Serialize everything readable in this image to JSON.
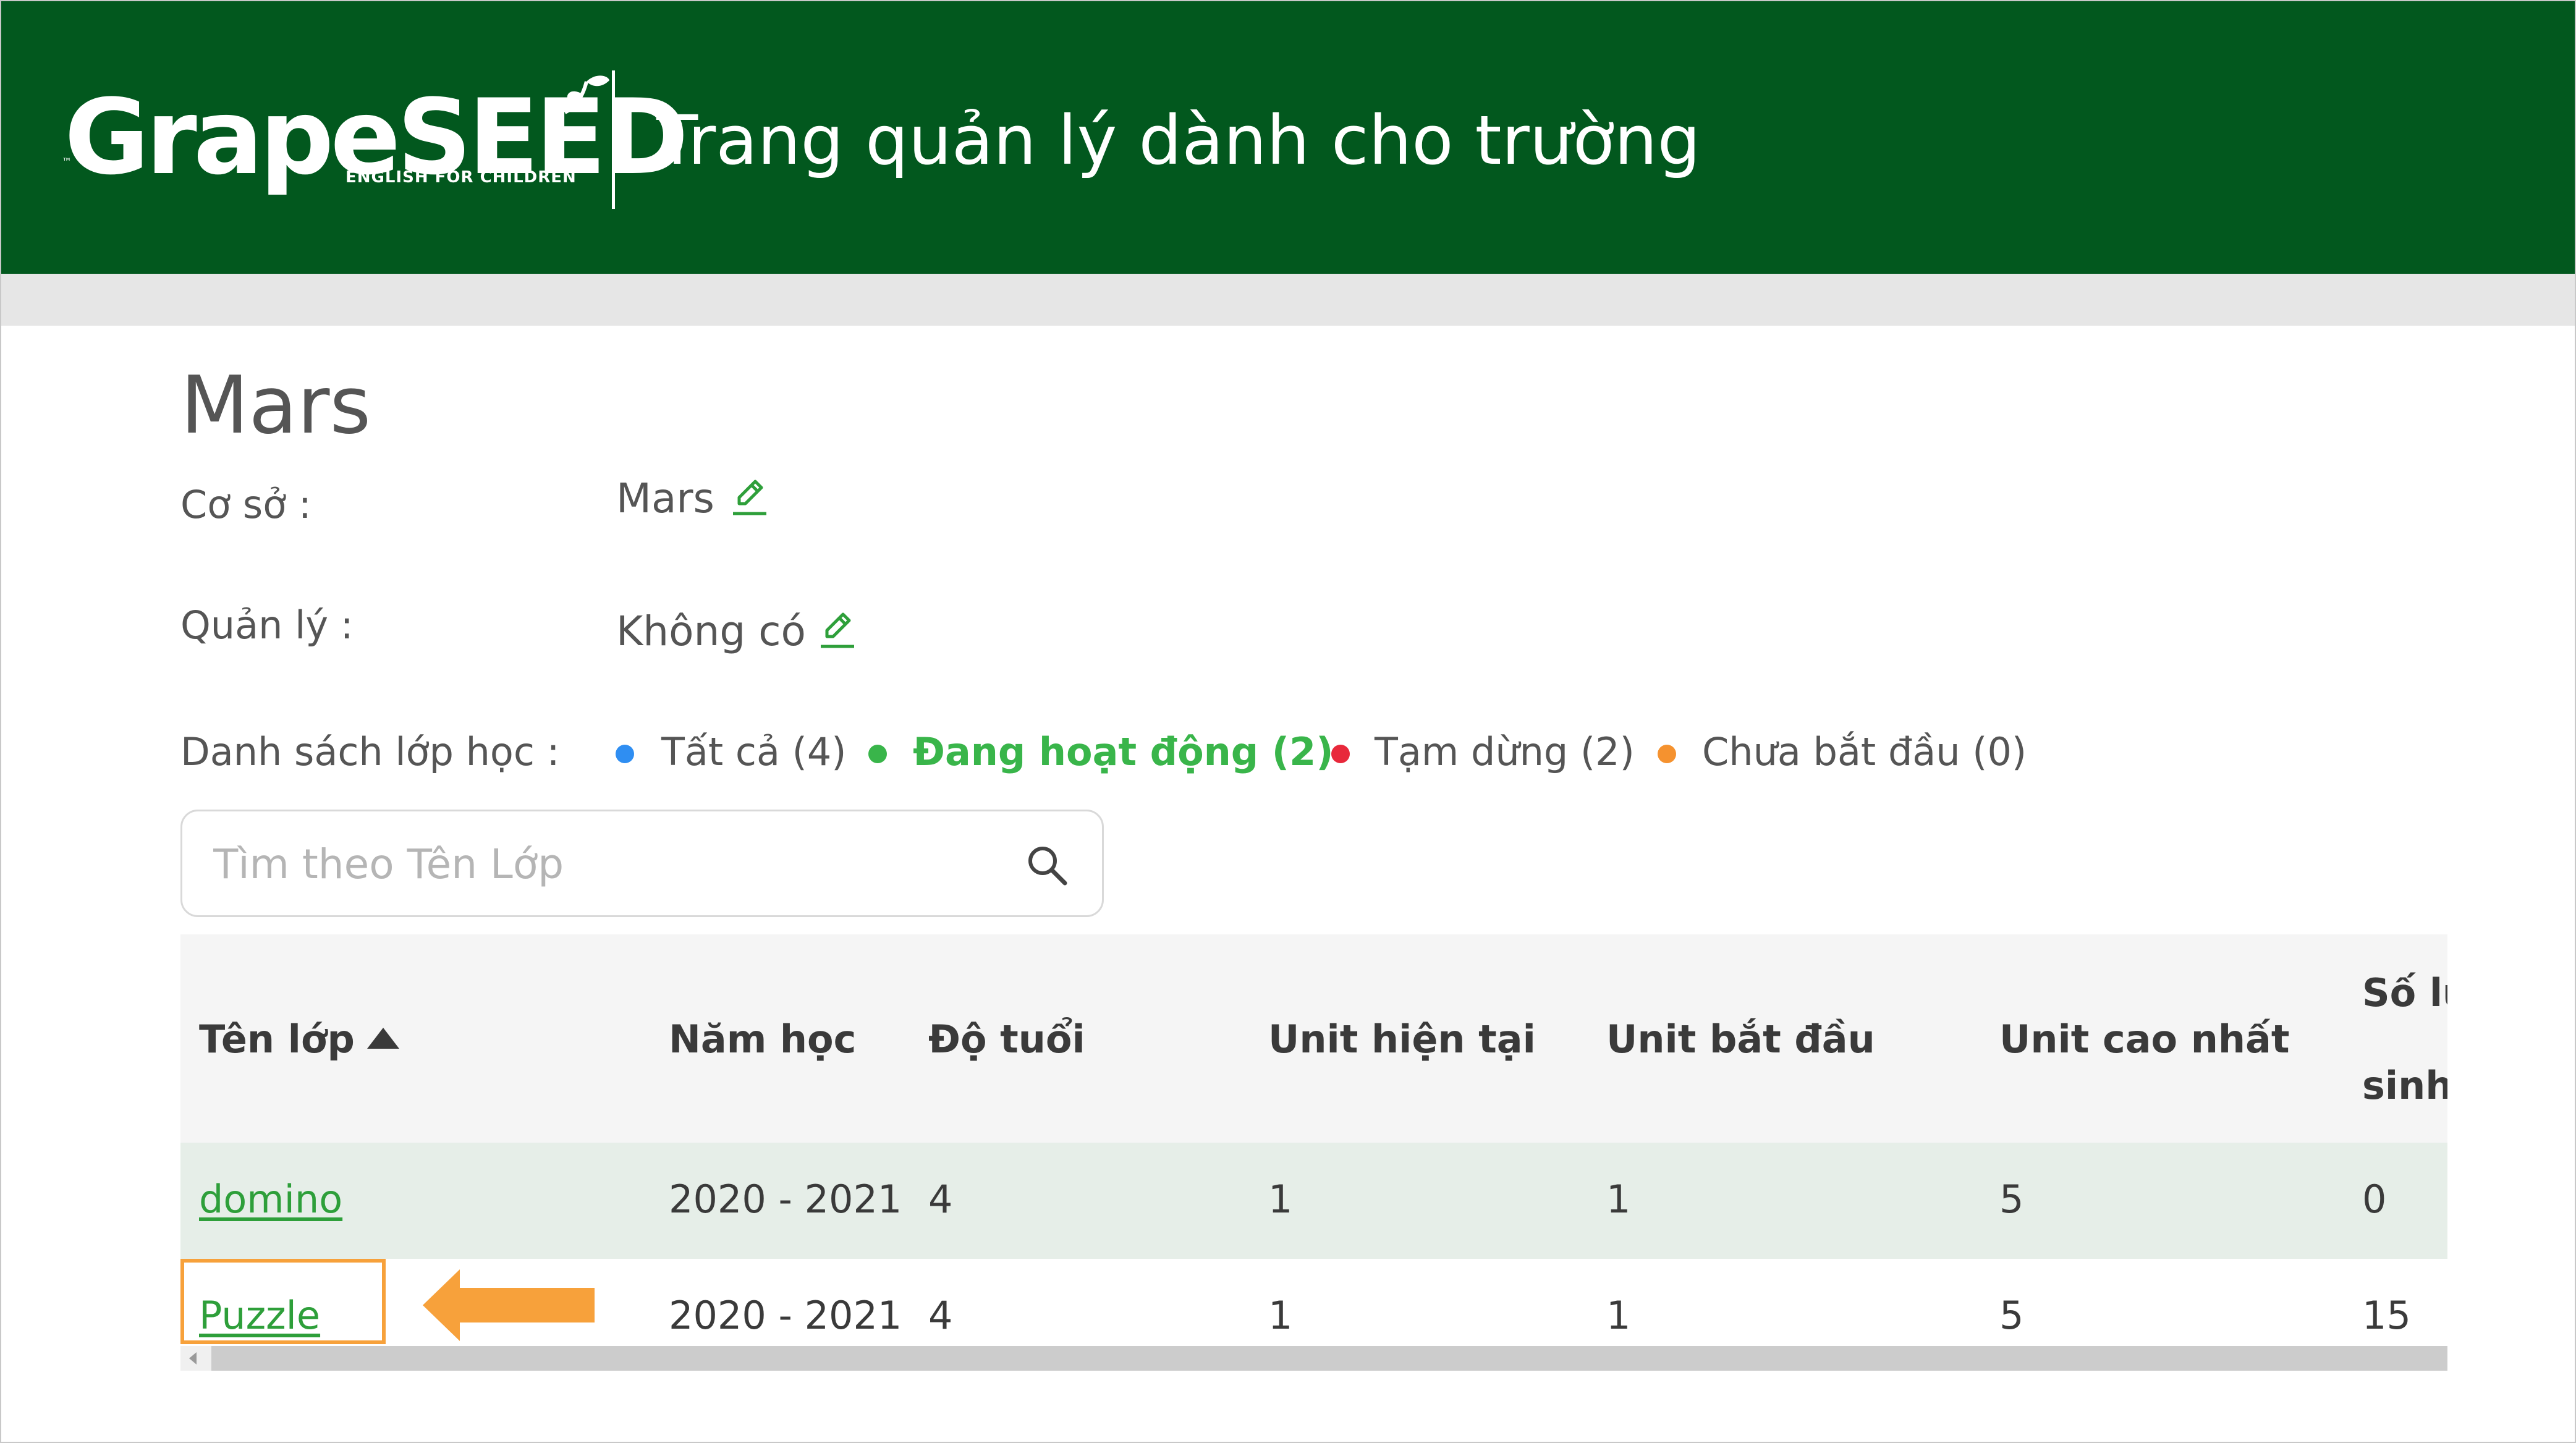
{
  "header": {
    "logo_text": "GrapeSEED",
    "logo_tagline": "ENGLISH FOR CHILDREN",
    "logo_tm": "™",
    "title": "Trang quản lý dành cho trường"
  },
  "school": {
    "name": "Mars",
    "campus_label": "Cơ sở :",
    "campus_value": "Mars",
    "manager_label": "Quản lý :",
    "manager_value": "Không có",
    "class_list_label": "Danh sách lớp học :"
  },
  "filters": [
    {
      "label": "Tất cả (4)",
      "color": "#2f8ef2",
      "active": false
    },
    {
      "label": "Đang hoạt động (2)",
      "color": "#39b54a",
      "active": true
    },
    {
      "label": "Tạm dừng (2)",
      "color": "#e8283b",
      "active": false
    },
    {
      "label": "Chưa bắt đầu (0)",
      "color": "#f5922f",
      "active": false
    }
  ],
  "search": {
    "placeholder": "Tìm theo Tên Lớp",
    "value": ""
  },
  "table": {
    "columns": [
      {
        "label": "Tên lớp",
        "sorted": "asc"
      },
      {
        "label": "Năm học"
      },
      {
        "label": "Độ tuổi"
      },
      {
        "label": "Unit hiện tại"
      },
      {
        "label": "Unit bắt đầu"
      },
      {
        "label": "Unit cao nhất"
      },
      {
        "label_line1": "Số lư",
        "label_line2": "sinh"
      }
    ],
    "rows": [
      {
        "name": "domino",
        "year": "2020 - 2021",
        "age": "4",
        "current_unit": "1",
        "start_unit": "1",
        "max_unit": "5",
        "count": "0"
      },
      {
        "name": "Puzzle",
        "year": "2020 - 2021",
        "age": "4",
        "current_unit": "1",
        "start_unit": "1",
        "max_unit": "5",
        "count": "15"
      }
    ]
  },
  "colors": {
    "header_bg": "#02581e",
    "accent_green": "#2e9f3a",
    "callout_orange": "#f7a13b"
  }
}
